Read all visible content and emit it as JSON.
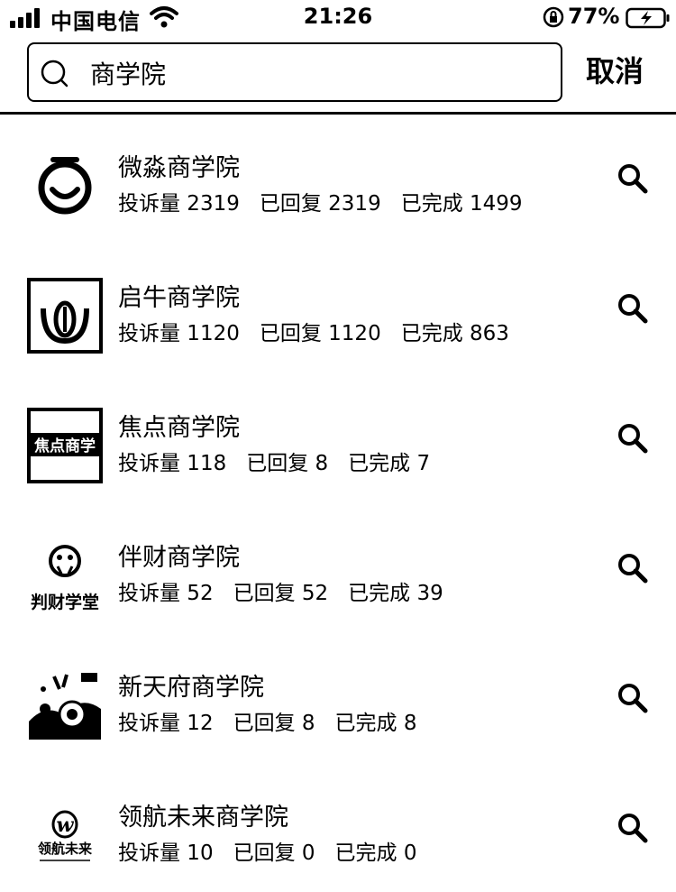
{
  "status_bar": {
    "carrier": "中国电信",
    "time": "21:26",
    "battery_percent": "77%",
    "icons": [
      "signal-icon",
      "wifi-icon",
      "rotation-lock-icon",
      "battery-charging-icon"
    ]
  },
  "search": {
    "value": "商学院",
    "placeholder": "",
    "cancel_label": "取消"
  },
  "results": [
    {
      "name": "微淼商学院",
      "stats": {
        "complaints": "投诉量 2319",
        "replied": "已回复 2319",
        "completed": "已完成 1499"
      },
      "logo_text": ""
    },
    {
      "name": "启牛商学院",
      "stats": {
        "complaints": "投诉量 1120",
        "replied": "已回复 1120",
        "completed": "已完成 863"
      },
      "logo_text": ""
    },
    {
      "name": "焦点商学院",
      "stats": {
        "complaints": "投诉量 118",
        "replied": "已回复 8",
        "completed": "已完成 7"
      },
      "logo_text": "焦点商学"
    },
    {
      "name": "伴财商学院",
      "stats": {
        "complaints": "投诉量 52",
        "replied": "已回复 52",
        "completed": "已完成 39"
      },
      "logo_text": "判财学堂"
    },
    {
      "name": "新天府商学院",
      "stats": {
        "complaints": "投诉量 12",
        "replied": "已回复 8",
        "completed": "已完成 8"
      },
      "logo_text": ""
    },
    {
      "name": "领航未来商学院",
      "stats": {
        "complaints": "投诉量 10",
        "replied": "已回复 0",
        "completed": "已完成 0"
      },
      "logo_text": "领航未来"
    }
  ],
  "colors": {
    "text": "#000000",
    "background": "#ffffff",
    "divider": "#000000"
  }
}
